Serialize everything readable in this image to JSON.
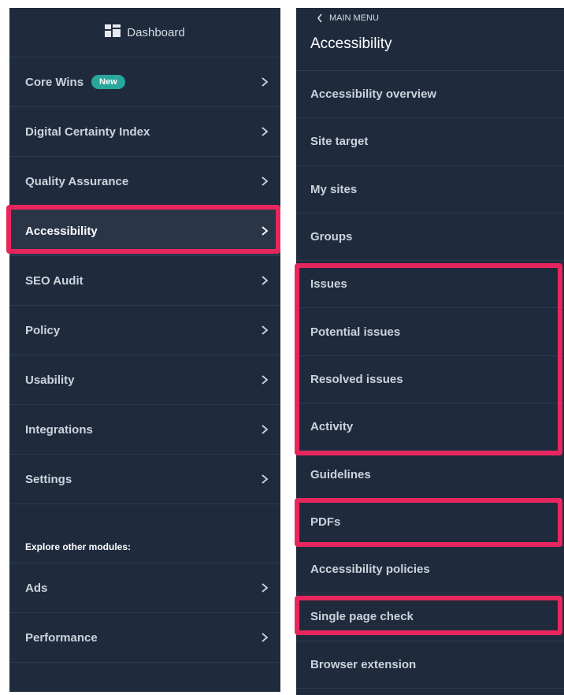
{
  "left_panel": {
    "header": {
      "title": "Dashboard",
      "icon": "dashboard-grid-icon"
    },
    "items": [
      {
        "label": "Core Wins",
        "badge": "New"
      },
      {
        "label": "Digital Certainty Index"
      },
      {
        "label": "Quality Assurance"
      },
      {
        "label": "Accessibility",
        "active": true
      },
      {
        "label": "SEO Audit"
      },
      {
        "label": "Policy"
      },
      {
        "label": "Usability"
      },
      {
        "label": "Integrations"
      },
      {
        "label": "Settings"
      }
    ],
    "explore_heading": "Explore other modules:",
    "modules": [
      {
        "label": "Ads"
      },
      {
        "label": "Performance"
      }
    ]
  },
  "right_panel": {
    "back_label": "MAIN MENU",
    "title": "Accessibility",
    "items": [
      {
        "label": "Accessibility overview"
      },
      {
        "label": "Site target"
      },
      {
        "label": "My sites"
      },
      {
        "label": "Groups"
      },
      {
        "label": "Issues"
      },
      {
        "label": "Potential issues"
      },
      {
        "label": "Resolved issues"
      },
      {
        "label": "Activity"
      },
      {
        "label": "Guidelines"
      },
      {
        "label": "PDFs"
      },
      {
        "label": "Accessibility policies"
      },
      {
        "label": "Single page check"
      },
      {
        "label": "Browser extension"
      }
    ]
  },
  "colors": {
    "panel_bg": "#1f2b3d",
    "highlight": "#e8265e",
    "badge": "#2aa79b"
  }
}
